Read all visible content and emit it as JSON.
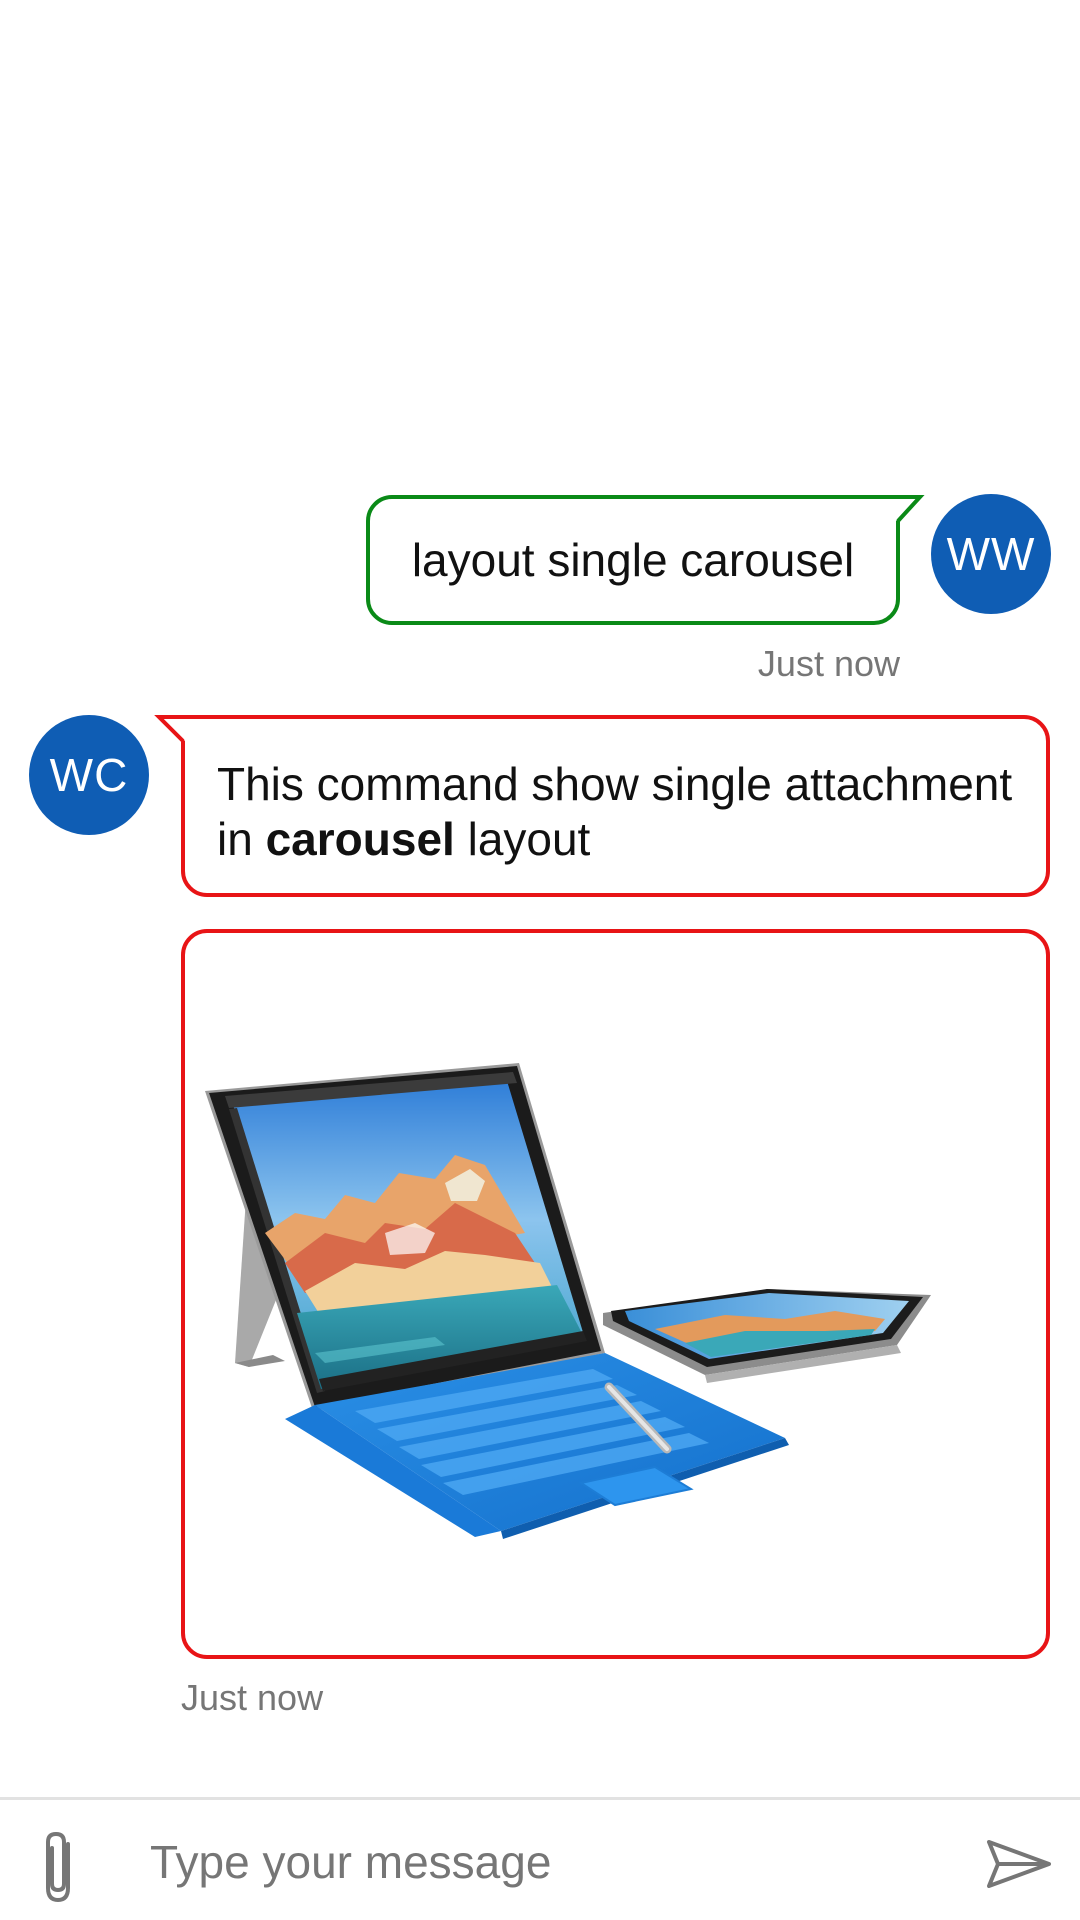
{
  "messages": {
    "user": {
      "avatar_initials": "WW",
      "text": "layout single carousel",
      "timestamp": "Just now",
      "border_color": "#0a8a17"
    },
    "bot": {
      "avatar_initials": "WC",
      "text_before": "This command show single attachment in ",
      "text_bold": "carousel",
      "text_after": " layout",
      "timestamp": "Just now",
      "border_color": "#e81416",
      "attachment": {
        "kind": "image",
        "subject": "laptop-tablet-with-blue-keyboard"
      }
    }
  },
  "composer": {
    "placeholder": "Type your message",
    "attach_icon": "paperclip-icon",
    "send_icon": "send-icon"
  },
  "colors": {
    "avatar_bg": "#0f5db4",
    "timestamp": "#767676"
  }
}
